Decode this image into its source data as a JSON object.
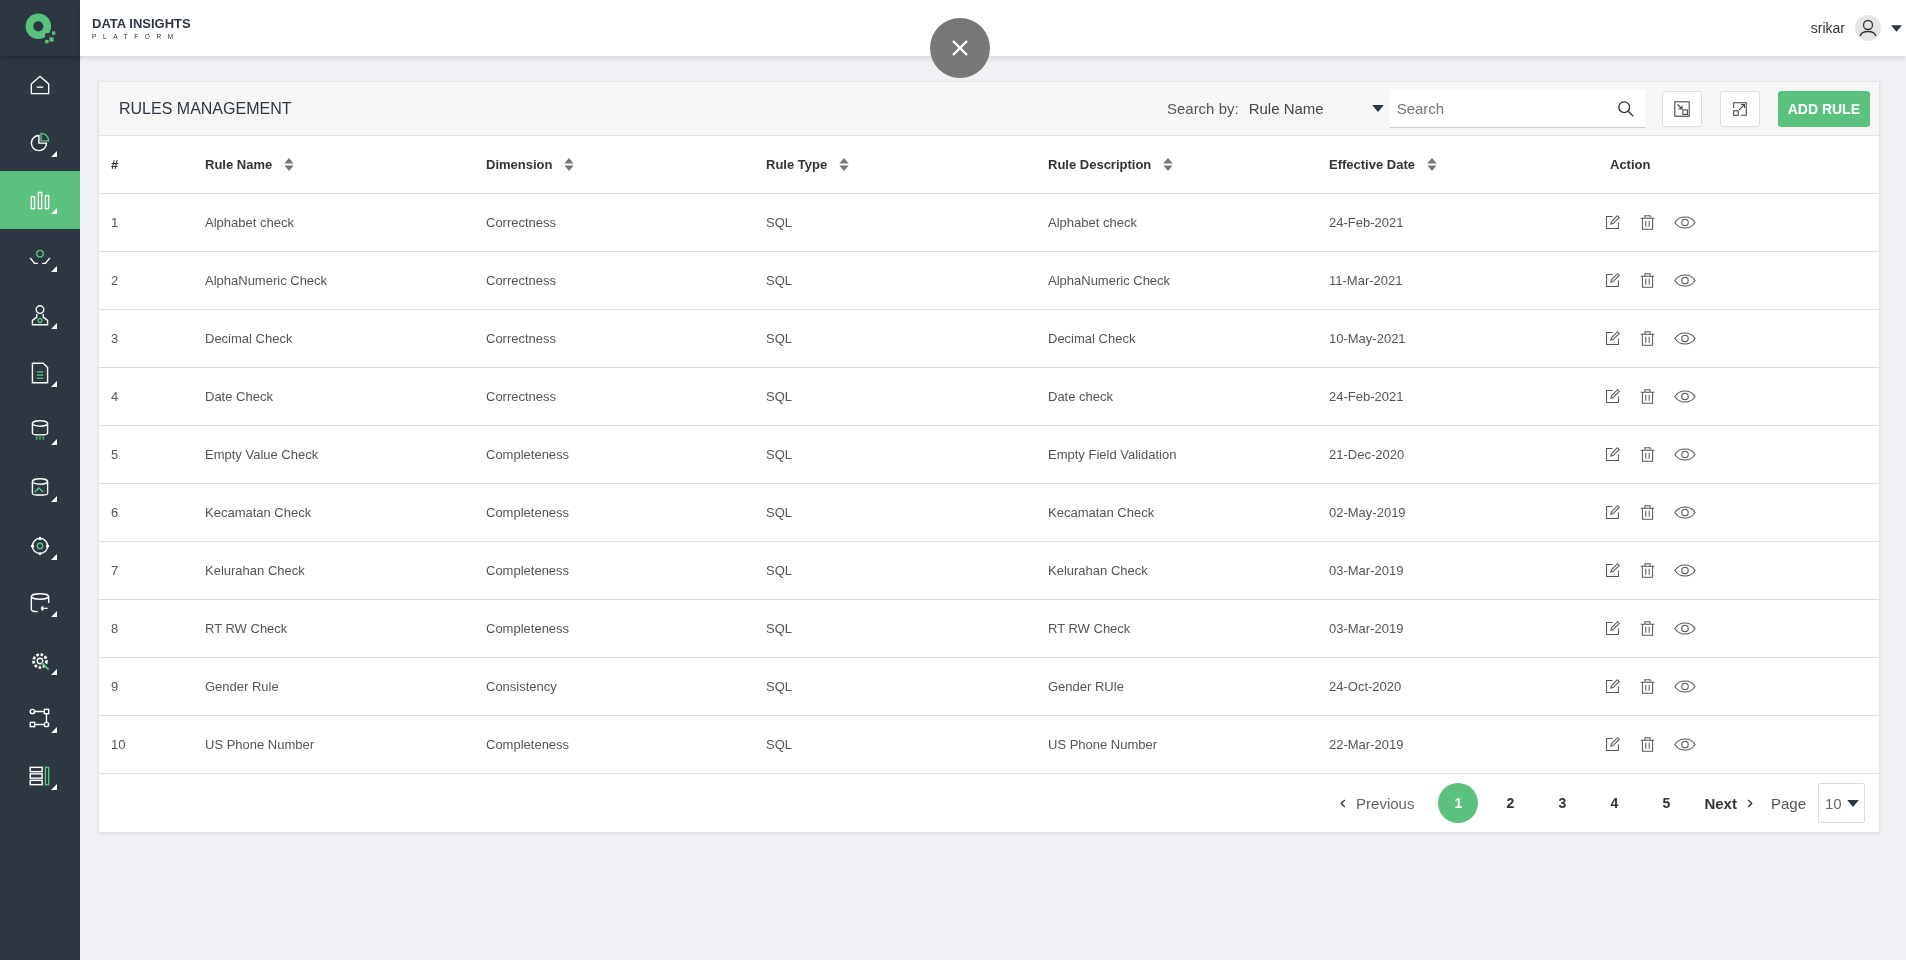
{
  "header": {
    "brand_title": "DATA INSIGHTS",
    "brand_subtitle": "PLATFORM",
    "user": "srikar"
  },
  "sidebar": {
    "items": [
      {
        "selected": false
      },
      {
        "selected": false
      },
      {
        "selected": true
      },
      {
        "selected": false
      },
      {
        "selected": false
      },
      {
        "selected": false
      },
      {
        "selected": false
      },
      {
        "selected": false
      },
      {
        "selected": false
      },
      {
        "selected": false
      },
      {
        "selected": false
      },
      {
        "selected": false
      },
      {
        "selected": false
      }
    ]
  },
  "panel": {
    "title": "RULES MANAGEMENT",
    "search_by_label": "Search by:",
    "search_by_value": "Rule Name",
    "search": {
      "placeholder": "Search"
    },
    "add_button": "ADD RULE"
  },
  "table": {
    "columns": [
      {
        "label": "#",
        "sortable": false
      },
      {
        "label": "Rule Name",
        "sortable": true
      },
      {
        "label": "Dimension",
        "sortable": true
      },
      {
        "label": "Rule Type",
        "sortable": true
      },
      {
        "label": "Rule Description",
        "sortable": true
      },
      {
        "label": "Effective Date",
        "sortable": true
      },
      {
        "label": "Action",
        "sortable": false
      }
    ],
    "rows": [
      [
        "1",
        "Alphabet check",
        "Correctness",
        "SQL",
        "Alphabet check",
        "24-Feb-2021"
      ],
      [
        "2",
        "AlphaNumeric Check",
        "Correctness",
        "SQL",
        "AlphaNumeric Check",
        "11-Mar-2021"
      ],
      [
        "3",
        "Decimal Check",
        "Correctness",
        "SQL",
        "Decimal Check",
        "10-May-2021"
      ],
      [
        "4",
        "Date Check",
        "Correctness",
        "SQL",
        "Date check",
        "24-Feb-2021"
      ],
      [
        "5",
        "Empty Value Check",
        "Completeness",
        "SQL",
        "Empty Field Validation",
        "21-Dec-2020"
      ],
      [
        "6",
        "Kecamatan Check",
        "Completeness",
        "SQL",
        "Kecamatan Check",
        "02-May-2019"
      ],
      [
        "7",
        "Kelurahan Check",
        "Completeness",
        "SQL",
        "Kelurahan Check",
        "03-Mar-2019"
      ],
      [
        "8",
        "RT RW Check",
        "Completeness",
        "SQL",
        "RT RW Check",
        "03-Mar-2019"
      ],
      [
        "9",
        "Gender Rule",
        "Consistency",
        "SQL",
        "Gender RUle",
        "24-Oct-2020"
      ],
      [
        "10",
        "US Phone Number",
        "Completeness",
        "SQL",
        "US Phone Number",
        "22-Mar-2019"
      ]
    ]
  },
  "pagination": {
    "previous": "Previous",
    "pages": [
      {
        "label": "1",
        "selected": true
      },
      {
        "label": "2",
        "selected": false
      },
      {
        "label": "3",
        "selected": false
      },
      {
        "label": "4",
        "selected": false
      },
      {
        "label": "5",
        "selected": false
      }
    ],
    "next": "Next",
    "page_label": "Page",
    "page_size": "10"
  }
}
